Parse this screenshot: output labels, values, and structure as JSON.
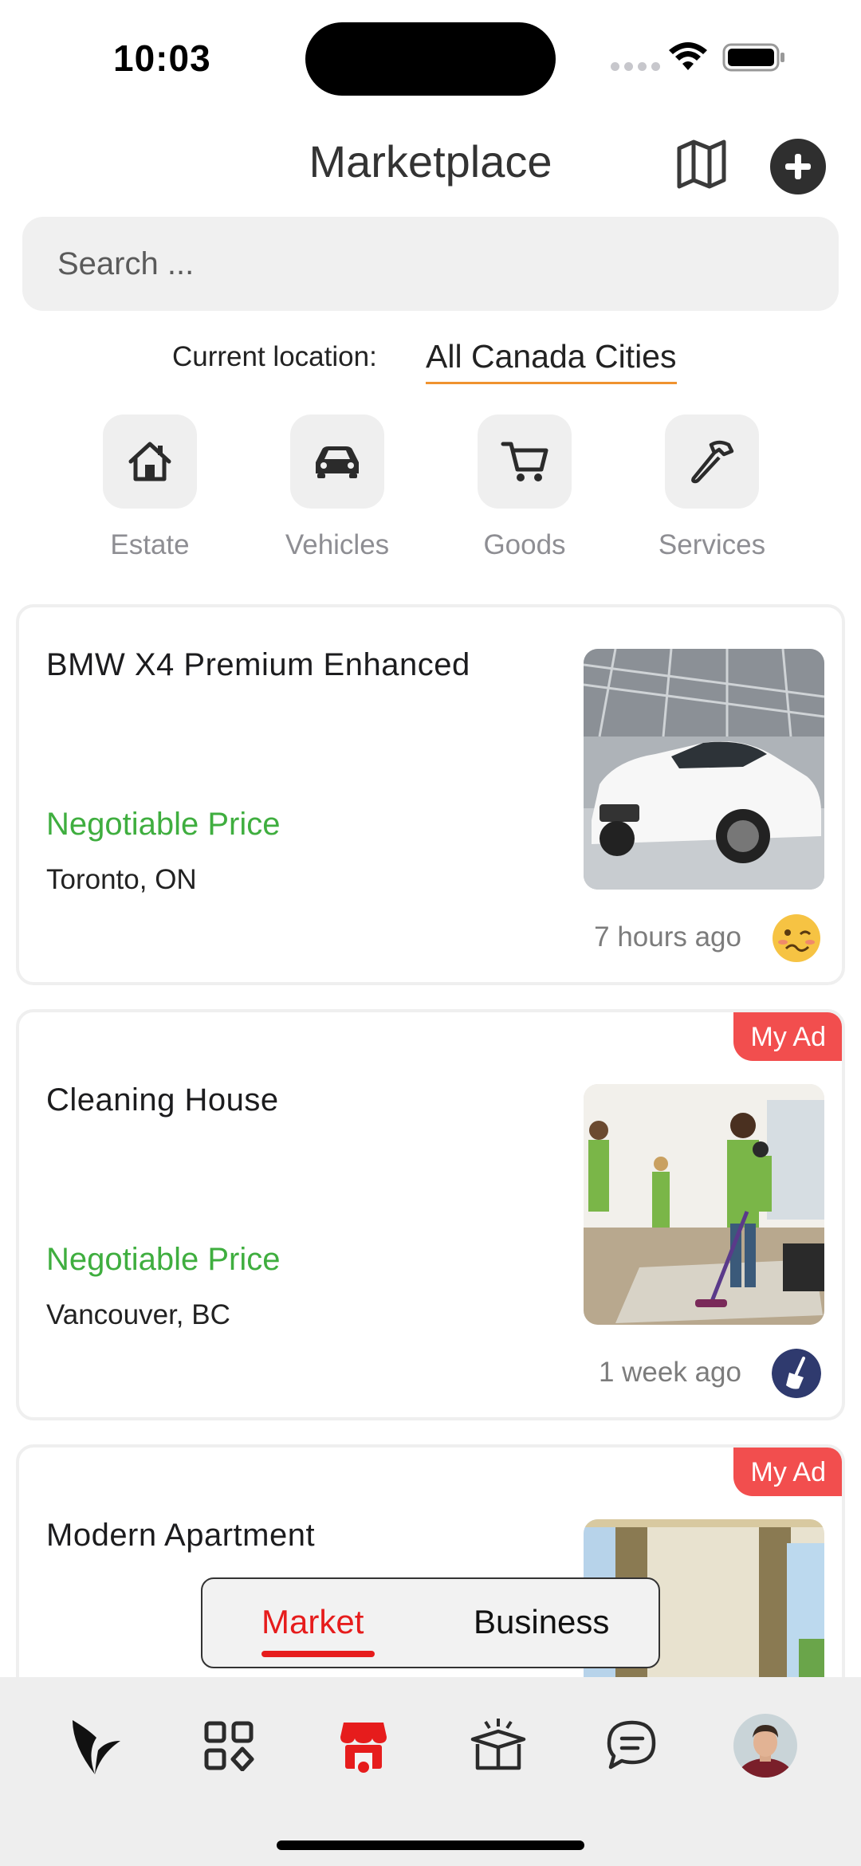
{
  "status_bar": {
    "time": "10:03"
  },
  "header": {
    "title": "Marketplace"
  },
  "search": {
    "placeholder": "Search ..."
  },
  "location": {
    "label": "Current location:",
    "value": "All Canada Cities"
  },
  "categories": [
    {
      "label": "Estate",
      "icon": "house-icon"
    },
    {
      "label": "Vehicles",
      "icon": "car-icon"
    },
    {
      "label": "Goods",
      "icon": "cart-icon"
    },
    {
      "label": "Services",
      "icon": "hammer-icon"
    }
  ],
  "listings": [
    {
      "title": "BMW X4 Premium Enhanced",
      "price": "Negotiable Price",
      "location": "Toronto, ON",
      "time": "7 hours ago",
      "my_ad": "",
      "thumb": "white-suv-photo",
      "avatar": "woozy-face-emoji"
    },
    {
      "title": "Cleaning House",
      "price": "Negotiable Price",
      "location": "Vancouver, BC",
      "time": "1 week ago",
      "my_ad": "My Ad",
      "thumb": "cleaning-team-photo",
      "avatar": "broom-icon"
    },
    {
      "title": "Modern Apartment",
      "price": "",
      "location": "",
      "time": "",
      "my_ad": "My Ad",
      "thumb": "apartment-window-photo",
      "avatar": ""
    }
  ],
  "toggle": {
    "market": "Market",
    "business": "Business"
  },
  "tabbar": {
    "items": [
      "logo-icon",
      "apps-icon",
      "store-icon",
      "gift-box-icon",
      "chat-icon",
      "profile-avatar"
    ],
    "active": "store-icon"
  },
  "colors": {
    "accent": "#e61c1c",
    "price_green": "#3fae3f",
    "badge_red": "#f24e4e",
    "location_underline": "#f0932f"
  }
}
